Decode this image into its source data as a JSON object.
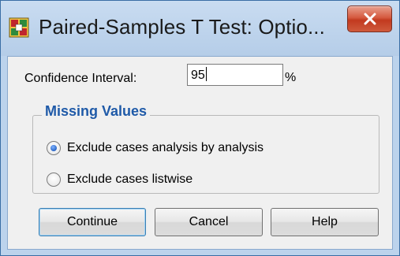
{
  "window": {
    "title": "Paired-Samples T Test: Optio...",
    "close_label": "X"
  },
  "confidence": {
    "label": "Confidence Interval:",
    "value": "95",
    "unit": "%"
  },
  "missing_values": {
    "legend": "Missing Values",
    "options": [
      {
        "label": "Exclude cases analysis by analysis",
        "checked": true
      },
      {
        "label": "Exclude cases listwise",
        "checked": false
      }
    ]
  },
  "buttons": {
    "continue": "Continue",
    "cancel": "Cancel",
    "help": "Help"
  },
  "colors": {
    "title_bar": "#bcd3ec",
    "close_button": "#c9472a",
    "group_legend": "#1f5aa8",
    "dialog_body": "#f0f0f0"
  }
}
